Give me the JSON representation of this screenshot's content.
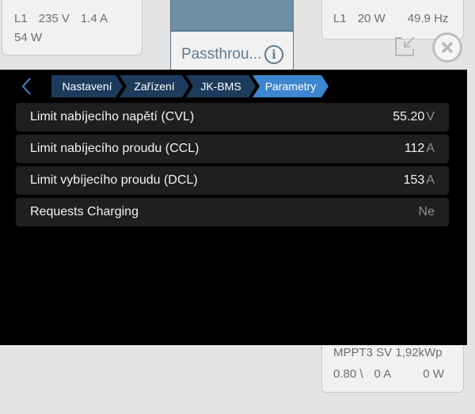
{
  "background": {
    "ac_input": {
      "phase": "L1",
      "voltage": "235 V",
      "current": "1.4 A",
      "power": "54 W"
    },
    "ac_output": {
      "phase": "L1",
      "power": "20 W",
      "frequency": "49.9 Hz"
    },
    "center_label": "Passthrou...",
    "mppt": {
      "title": "MPPT3 SV 1,92kWp",
      "voltage": "0.80 \\",
      "current": "0 A",
      "power": "0 W"
    }
  },
  "breadcrumb": [
    "Nastavení",
    "Zařízení",
    "JK-BMS",
    "Parametry"
  ],
  "rows": [
    {
      "label": "Limit nabíjecího napětí (CVL)",
      "value": "55.20",
      "unit": "V"
    },
    {
      "label": "Limit nabíjecího proudu (CCL)",
      "value": "112",
      "unit": "A"
    },
    {
      "label": "Limit vybíjecího proudu (DCL)",
      "value": "153",
      "unit": "A"
    },
    {
      "label": "Requests Charging",
      "value": "Ne",
      "unit": ""
    }
  ],
  "colors": {
    "crumb": "#1d3c5d",
    "crumb_active": "#3e86cf",
    "row_bg": "#1f1f1f",
    "accent_back": "#3e86cf"
  },
  "icons": {
    "back": "chevron-left-icon",
    "info": "info-icon",
    "popout": "popout-icon",
    "close": "close-icon"
  }
}
